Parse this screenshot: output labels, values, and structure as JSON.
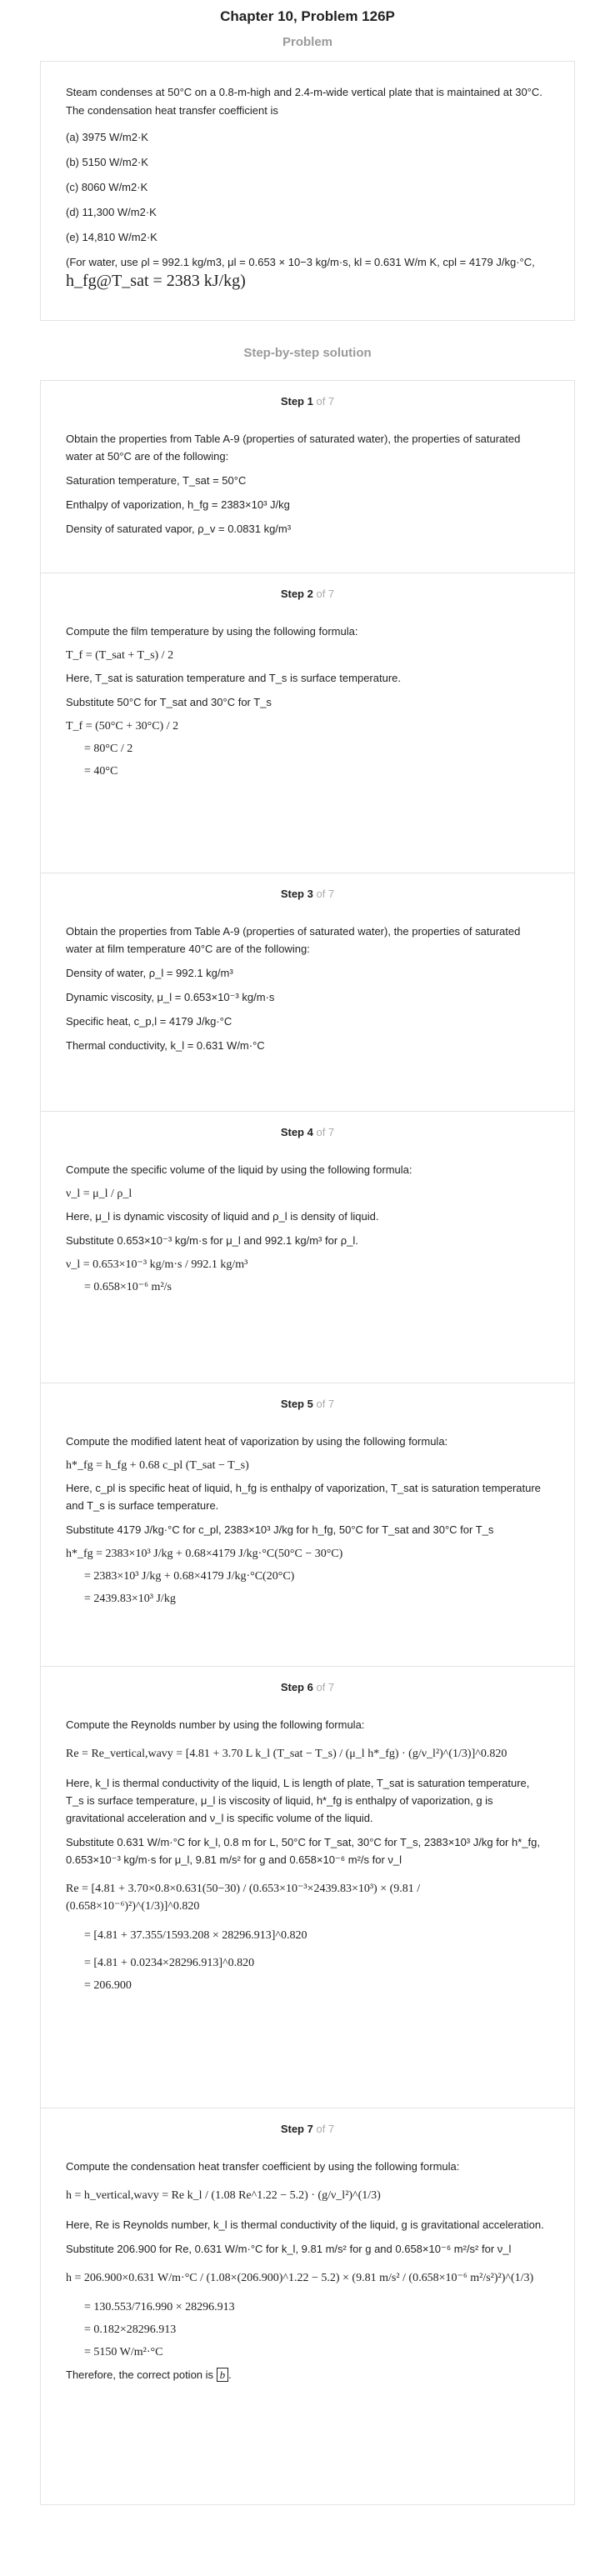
{
  "header": {
    "title": "Chapter 10, Problem 126P",
    "problem_label": "Problem",
    "solution_label": "Step-by-step solution"
  },
  "problem": {
    "statement": "Steam condenses at 50°C on a 0.8-m-high and 2.4-m-wide vertical plate that is maintained at 30°C. The condensation heat transfer coefficient is",
    "options": [
      "(a) 3975 W/m2·K",
      "(b) 5150 W/m2·K",
      "(c) 8060 W/m2·K",
      "(d) 11,300 W/m2·K",
      "(e) 14,810 W/m2·K"
    ],
    "note": "(For water, use ρl = 992.1 kg/m3, μl = 0.653 × 10−3 kg/m·s, kl = 0.631 W/m K, cpl = 4179 J/kg·°C,",
    "note_formula": "h_fg@T_sat = 2383 kJ/kg)"
  },
  "steps": [
    {
      "label": "Step 1",
      "of": "of 7",
      "intro": "Obtain the properties from Table A-9 (properties of saturated water), the properties of saturated water at 50°C are of the following:",
      "lines": [
        "Saturation temperature, T_sat = 50°C",
        "Enthalpy of vaporization, h_fg = 2383×10³ J/kg",
        "Density of saturated vapor, ρ_v = 0.0831 kg/m³"
      ]
    },
    {
      "label": "Step 2",
      "of": "of 7",
      "intro": "Compute the film temperature by using the following formula:",
      "formula": "T_f = (T_sat + T_s) / 2",
      "here": "Here, T_sat is saturation temperature and T_s is surface temperature.",
      "substitute": "Substitute 50°C for T_sat and 30°C for T_s",
      "calc": [
        "T_f = (50°C + 30°C) / 2",
        "= 80°C / 2",
        "= 40°C"
      ]
    },
    {
      "label": "Step 3",
      "of": "of 7",
      "intro": "Obtain the properties from Table A-9 (properties of saturated water), the properties of saturated water at film temperature 40°C are of the following:",
      "lines": [
        "Density of water, ρ_l = 992.1 kg/m³",
        "Dynamic viscosity, μ_l = 0.653×10⁻³ kg/m·s",
        "Specific heat, c_p,l = 4179 J/kg·°C",
        "Thermal conductivity, k_l = 0.631 W/m·°C"
      ]
    },
    {
      "label": "Step 4",
      "of": "of 7",
      "intro": "Compute the specific volume of the liquid by using the following formula:",
      "formula": "ν_l = μ_l / ρ_l",
      "here": "Here, μ_l is dynamic viscosity of liquid and ρ_l is density of liquid.",
      "substitute": "Substitute 0.653×10⁻³ kg/m·s for μ_l and 992.1 kg/m³ for ρ_l.",
      "calc": [
        "ν_l = 0.653×10⁻³ kg/m·s / 992.1 kg/m³",
        "= 0.658×10⁻⁶ m²/s"
      ]
    },
    {
      "label": "Step 5",
      "of": "of 7",
      "intro": "Compute the modified latent heat of vaporization by using the following formula:",
      "formula": "h*_fg = h_fg + 0.68 c_pl (T_sat − T_s)",
      "here": "Here, c_pl is specific heat of liquid, h_fg is enthalpy of vaporization, T_sat is saturation temperature and T_s is surface temperature.",
      "substitute": "Substitute 4179 J/kg·°C for c_pl, 2383×10³ J/kg for h_fg, 50°C for T_sat and 30°C for T_s",
      "calc": [
        "h*_fg = 2383×10³ J/kg + 0.68×4179 J/kg·°C(50°C − 30°C)",
        "= 2383×10³ J/kg + 0.68×4179 J/kg·°C(20°C)",
        "= 2439.83×10³ J/kg"
      ]
    },
    {
      "label": "Step 6",
      "of": "of 7",
      "intro": "Compute the Reynolds number by using the following formula:",
      "formula": "Re = Re_vertical,wavy = [4.81 + 3.70 L k_l (T_sat − T_s) / (μ_l h*_fg) · (g/ν_l²)^(1/3)]^0.820",
      "here": "Here, k_l is thermal conductivity of the liquid, L is length of plate, T_sat is saturation temperature, T_s is surface temperature, μ_l is viscosity of liquid, h*_fg is enthalpy of vaporization, g is gravitational acceleration and ν_l is specific volume of the liquid.",
      "substitute": "Substitute 0.631 W/m·°C for k_l, 0.8 m for L, 50°C for T_sat, 30°C for T_s, 2383×10³ J/kg for h*_fg, 0.653×10⁻³ kg/m·s for μ_l, 9.81 m/s² for g and 0.658×10⁻⁶ m²/s for ν_l",
      "calc": [
        "Re = [4.81 + 3.70×0.8×0.631(50−30) / (0.653×10⁻³×2439.83×10³) × (9.81 / (0.658×10⁻⁶)²)^(1/3)]^0.820",
        "= [4.81 + 37.355/1593.208 × 28296.913]^0.820",
        "= [4.81 + 0.0234×28296.913]^0.820",
        "= 206.900"
      ]
    },
    {
      "label": "Step 7",
      "of": "of 7",
      "intro": "Compute the condensation heat transfer coefficient by using the following formula:",
      "formula": "h = h_vertical,wavy = Re k_l / (1.08 Re^1.22 − 5.2) · (g/ν_l²)^(1/3)",
      "here": "Here, Re is Reynolds number, k_l is thermal conductivity of the liquid, g is gravitational acceleration.",
      "substitute": "Substitute 206.900 for Re, 0.631 W/m·°C for k_l, 9.81 m/s² for g and 0.658×10⁻⁶ m²/s² for ν_l",
      "calc": [
        "h = 206.900×0.631 W/m·°C / (1.08×(206.900)^1.22 − 5.2) × (9.81 m/s² / (0.658×10⁻⁶ m²/s²)²)^(1/3)",
        "= 130.553/716.990 × 28296.913",
        "= 0.182×28296.913",
        "= 5150 W/m²·°C"
      ],
      "conclusion": "Therefore, the correct potion is",
      "answer": "b"
    }
  ]
}
